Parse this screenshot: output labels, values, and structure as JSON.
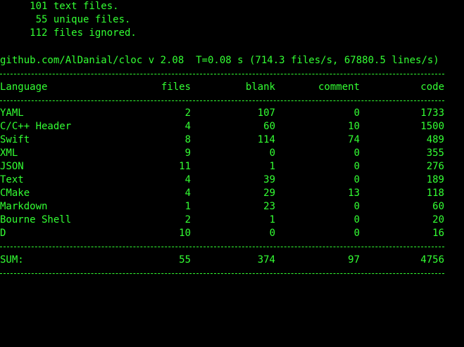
{
  "summary_lines": [
    "     101 text files.",
    "      55 unique files.",
    "     112 files ignored."
  ],
  "header_line": "github.com/AlDanial/cloc v 2.08  T=0.08 s (714.3 files/s, 67880.5 lines/s)",
  "columns": {
    "language": "Language",
    "files": "files",
    "blank": "blank",
    "comment": "comment",
    "code": "code"
  },
  "rows": [
    {
      "language": "YAML",
      "files": "2",
      "blank": "107",
      "comment": "0",
      "code": "1733"
    },
    {
      "language": "C/C++ Header",
      "files": "4",
      "blank": "60",
      "comment": "10",
      "code": "1500"
    },
    {
      "language": "Swift",
      "files": "8",
      "blank": "114",
      "comment": "74",
      "code": "489"
    },
    {
      "language": "XML",
      "files": "9",
      "blank": "0",
      "comment": "0",
      "code": "355"
    },
    {
      "language": "JSON",
      "files": "11",
      "blank": "1",
      "comment": "0",
      "code": "276"
    },
    {
      "language": "Text",
      "files": "4",
      "blank": "39",
      "comment": "0",
      "code": "189"
    },
    {
      "language": "CMake",
      "files": "4",
      "blank": "29",
      "comment": "13",
      "code": "118"
    },
    {
      "language": "Markdown",
      "files": "1",
      "blank": "23",
      "comment": "0",
      "code": "60"
    },
    {
      "language": "Bourne Shell",
      "files": "2",
      "blank": "1",
      "comment": "0",
      "code": "20"
    },
    {
      "language": "D",
      "files": "10",
      "blank": "0",
      "comment": "0",
      "code": "16"
    }
  ],
  "sum": {
    "language": "SUM:",
    "files": "55",
    "blank": "374",
    "comment": "97",
    "code": "4756"
  },
  "colors": {
    "background": "#000000",
    "text": "#33ff33"
  }
}
